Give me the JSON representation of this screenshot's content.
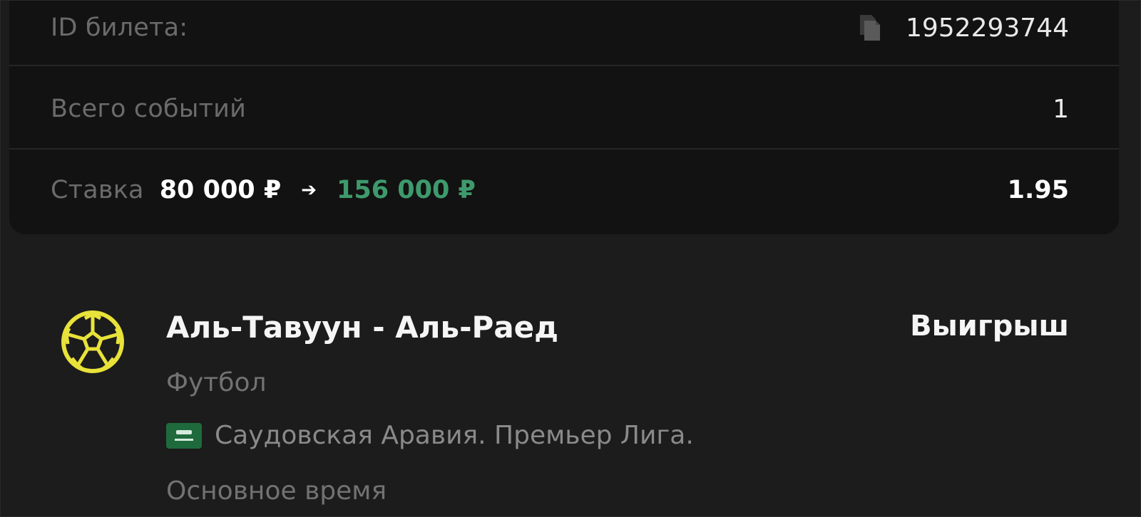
{
  "ticket": {
    "id_label": "ID билета:",
    "id_value": "1952293744",
    "events_label": "Всего событий",
    "events_value": "1",
    "stake_label": "Ставка",
    "stake_amount": "80 000 ₽",
    "stake_win": "156 000 ₽",
    "coefficient": "1.95"
  },
  "event": {
    "match": "Аль-Тавуун - Аль-Раед",
    "result": "Выигрыш",
    "sport": "Футбол",
    "league": "Саудовская Аравия. Премьер Лига.",
    "period": "Основное время",
    "icons": {
      "sport_icon": "football-icon",
      "flag_icon": "saudi-arabia-flag-icon"
    }
  },
  "colors": {
    "background": "#1c1c1c",
    "card": "#121212",
    "win_green": "#3e9a6c",
    "ball_yellow": "#e8e23a",
    "muted_text": "#6b6b6b"
  },
  "icons": {
    "copy": "copy-icon",
    "arrow": "arrow-right-icon"
  }
}
